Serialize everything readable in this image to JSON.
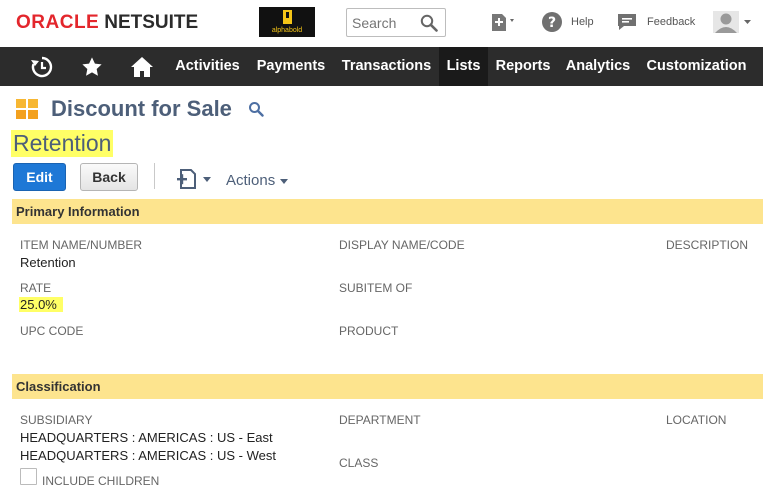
{
  "header": {
    "logo_oracle": "ORACLE",
    "logo_netsuite": "NETSUITE",
    "brand_name": "alphabold",
    "search_placeholder": "Search",
    "help_label": "Help",
    "feedback_label": "Feedback"
  },
  "nav": {
    "items": [
      {
        "label": "Activities"
      },
      {
        "label": "Payments"
      },
      {
        "label": "Transactions"
      },
      {
        "label": "Lists"
      },
      {
        "label": "Reports"
      },
      {
        "label": "Analytics"
      },
      {
        "label": "Customization"
      }
    ],
    "active": "Lists"
  },
  "page": {
    "title": "Discount for Sale",
    "record_name": "Retention"
  },
  "toolbar": {
    "edit_label": "Edit",
    "back_label": "Back",
    "actions_label": "Actions"
  },
  "primary": {
    "header": "Primary Information",
    "item_name_label": "ITEM NAME/NUMBER",
    "item_name_value": "Retention",
    "display_name_label": "DISPLAY NAME/CODE",
    "description_label": "DESCRIPTION",
    "rate_label": "RATE",
    "rate_value": "25.0%",
    "subitem_label": "SUBITEM OF",
    "upc_label": "UPC CODE",
    "product_label": "PRODUCT"
  },
  "classification": {
    "header": "Classification",
    "subsidiary_label": "SUBSIDIARY",
    "subsidiary_values": [
      "HEADQUARTERS : AMERICAS : US - East",
      "HEADQUARTERS : AMERICAS : US - West"
    ],
    "department_label": "DEPARTMENT",
    "location_label": "LOCATION",
    "class_label": "CLASS",
    "include_children_label": "INCLUDE CHILDREN"
  },
  "colors": {
    "nav_bg": "#2c2c2c",
    "section_bg": "#fde48e",
    "highlight": "#ffff66",
    "title": "#4d5f79",
    "edit_button": "#1e78d6",
    "oracle_red": "#e3262c"
  },
  "icons": {
    "recent": "recent-icon",
    "favorites": "star-icon",
    "home": "home-icon",
    "record": "discount-record-icon",
    "print": "print-icon"
  }
}
